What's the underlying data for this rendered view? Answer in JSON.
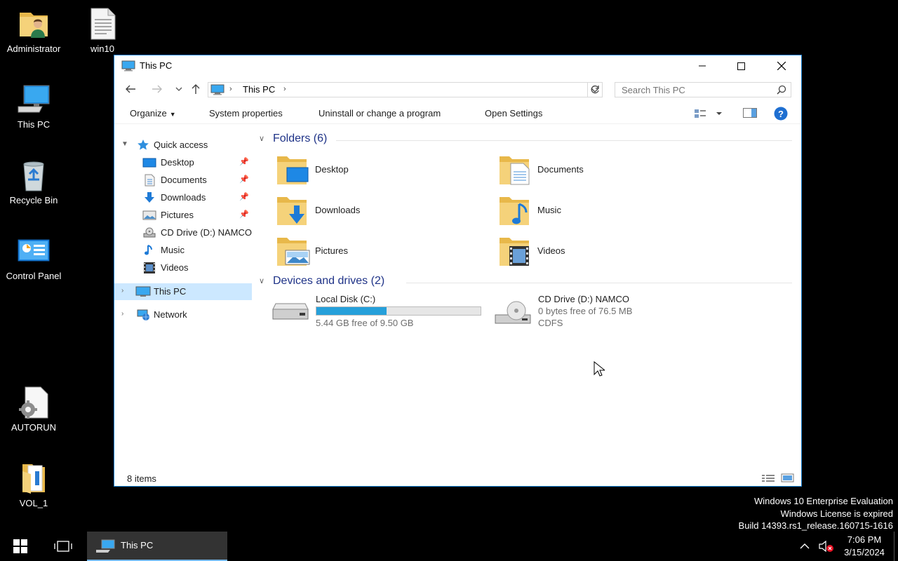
{
  "desktop": {
    "icons": [
      {
        "label": "Administrator"
      },
      {
        "label": "win10"
      },
      {
        "label": "This PC"
      },
      {
        "label": "Recycle Bin"
      },
      {
        "label": "Control Panel"
      },
      {
        "label": "AUTORUN"
      },
      {
        "label": "VOL_1"
      }
    ]
  },
  "window": {
    "title": "This PC",
    "address": {
      "crumb": "This PC"
    },
    "search": {
      "placeholder": "Search This PC"
    },
    "commands": {
      "organize": "Organize",
      "system_properties": "System properties",
      "uninstall": "Uninstall or change a program",
      "open_settings": "Open Settings"
    },
    "nav": {
      "quick_access": "Quick access",
      "items": [
        {
          "label": "Desktop",
          "pinned": true
        },
        {
          "label": "Documents",
          "pinned": true
        },
        {
          "label": "Downloads",
          "pinned": true
        },
        {
          "label": "Pictures",
          "pinned": true
        },
        {
          "label": "CD Drive (D:) NAMCO",
          "pinned": false
        },
        {
          "label": "Music",
          "pinned": false
        },
        {
          "label": "Videos",
          "pinned": false
        }
      ],
      "this_pc": "This PC",
      "network": "Network"
    },
    "folders_header": "Folders (6)",
    "folders": [
      {
        "label": "Desktop"
      },
      {
        "label": "Documents"
      },
      {
        "label": "Downloads"
      },
      {
        "label": "Music"
      },
      {
        "label": "Pictures"
      },
      {
        "label": "Videos"
      }
    ],
    "devices_header": "Devices and drives (2)",
    "drives": [
      {
        "name": "Local Disk (C:)",
        "free_text": "5.44 GB free of 9.50 GB",
        "used_fraction": 0.427
      },
      {
        "name": "CD Drive (D:) NAMCO",
        "free_text": "0 bytes free of 76.5 MB",
        "fs": "CDFS"
      }
    ],
    "status": "8 items"
  },
  "watermark": {
    "line1": "Windows 10 Enterprise Evaluation",
    "line2": "Windows License is expired",
    "line3": "Build 14393.rs1_release.160715-1616"
  },
  "taskbar": {
    "app_label": "This PC",
    "time": "7:06 PM",
    "date": "3/15/2024"
  },
  "colors": {
    "selection": "#cce8ff",
    "group_header": "#1e3287",
    "progress": "#26a0da",
    "window_border": "#1883d7"
  }
}
